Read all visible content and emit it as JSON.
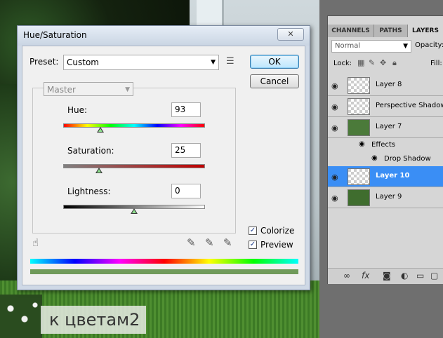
{
  "dialog": {
    "title": "Hue/Saturation",
    "close_glyph": "✕",
    "preset_label": "Preset:",
    "preset_value": "Custom",
    "channel_value": "Master",
    "ok_label": "OK",
    "cancel_label": "Cancel",
    "hue_label": "Hue:",
    "hue_value": "93",
    "saturation_label": "Saturation:",
    "saturation_value": "25",
    "lightness_label": "Lightness:",
    "lightness_value": "0",
    "colorize_label": "Colorize",
    "colorize_checked": true,
    "preview_label": "Preview",
    "preview_checked": true
  },
  "panel": {
    "tabs": [
      "CHANNELS",
      "PATHS",
      "LAYERS"
    ],
    "active_tab": "LAYERS",
    "blend_mode": "Normal",
    "opacity_label": "Opacity:",
    "lock_label": "Lock:",
    "fill_label": "Fill:",
    "layers": [
      {
        "name": "Layer 8",
        "selected": false
      },
      {
        "name": "Perspective Shadow",
        "selected": false
      },
      {
        "name": "Layer 7",
        "selected": false
      },
      {
        "name": "Layer 10",
        "selected": true
      },
      {
        "name": "Layer 9",
        "selected": false
      }
    ],
    "effects_label": "Effects",
    "drop_shadow_label": "Drop Shadow"
  },
  "caption": {
    "text": "к цветам2"
  },
  "colors": {
    "selected_layer": "#3a8ef5",
    "ok_border": "#3c7fb1",
    "result_bar": "#6f9a5a"
  }
}
